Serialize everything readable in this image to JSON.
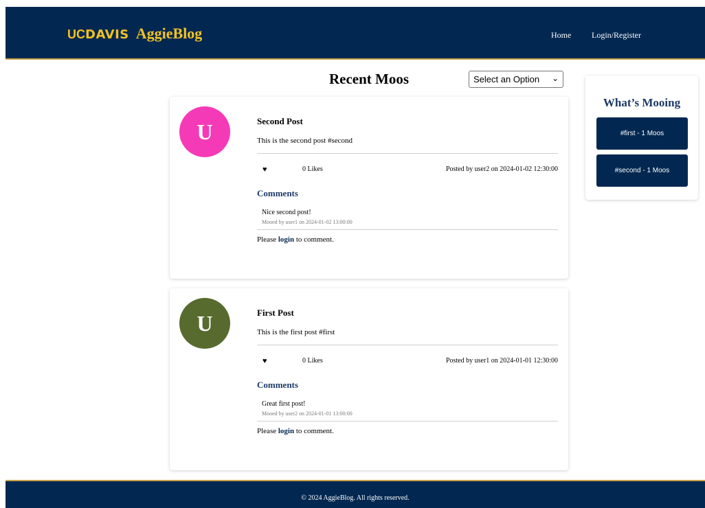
{
  "header": {
    "logo_uc": "UC",
    "logo_davis": "DAVIS",
    "brand": "AggieBlog",
    "nav": {
      "home": "Home",
      "login_register": "Login/Register"
    },
    "colors": {
      "navy": "#022851",
      "gold": "#f5c122"
    }
  },
  "main": {
    "title": "Recent Moos",
    "sort_select": {
      "selected": "Select an Option"
    },
    "posts": [
      {
        "avatar_letter": "U",
        "avatar_color": "#f53ab8",
        "title": "Second Post",
        "body": "This is the second post #second",
        "heart_icon": "heart-icon",
        "likes": "0 Likes",
        "posted": "Posted by user2 on 2024-01-02 12:30:00",
        "comments_heading": "Comments",
        "comments": [
          {
            "text": "Nice second post!",
            "meta": "Mooed by user1 on 2024-01-02 13:00:00"
          }
        ],
        "login_prompt": {
          "pre": "Please ",
          "link": "login",
          "post": " to comment."
        }
      },
      {
        "avatar_letter": "U",
        "avatar_color": "#576b2e",
        "title": "First Post",
        "body": "This is the first post #first",
        "heart_icon": "heart-icon",
        "likes": "0 Likes",
        "posted": "Posted by user1 on 2024-01-01 12:30:00",
        "comments_heading": "Comments",
        "comments": [
          {
            "text": "Great first post!",
            "meta": "Mooed by user2 on 2024-01-01 13:00:00"
          }
        ],
        "login_prompt": {
          "pre": "Please ",
          "link": "login",
          "post": " to comment."
        }
      }
    ]
  },
  "sidebar": {
    "title": "What’s Mooing",
    "tags": [
      "#first - 1 Moos",
      "#second - 1 Moos"
    ]
  },
  "footer": {
    "text": "© 2024 AggieBlog. All rights reserved."
  }
}
